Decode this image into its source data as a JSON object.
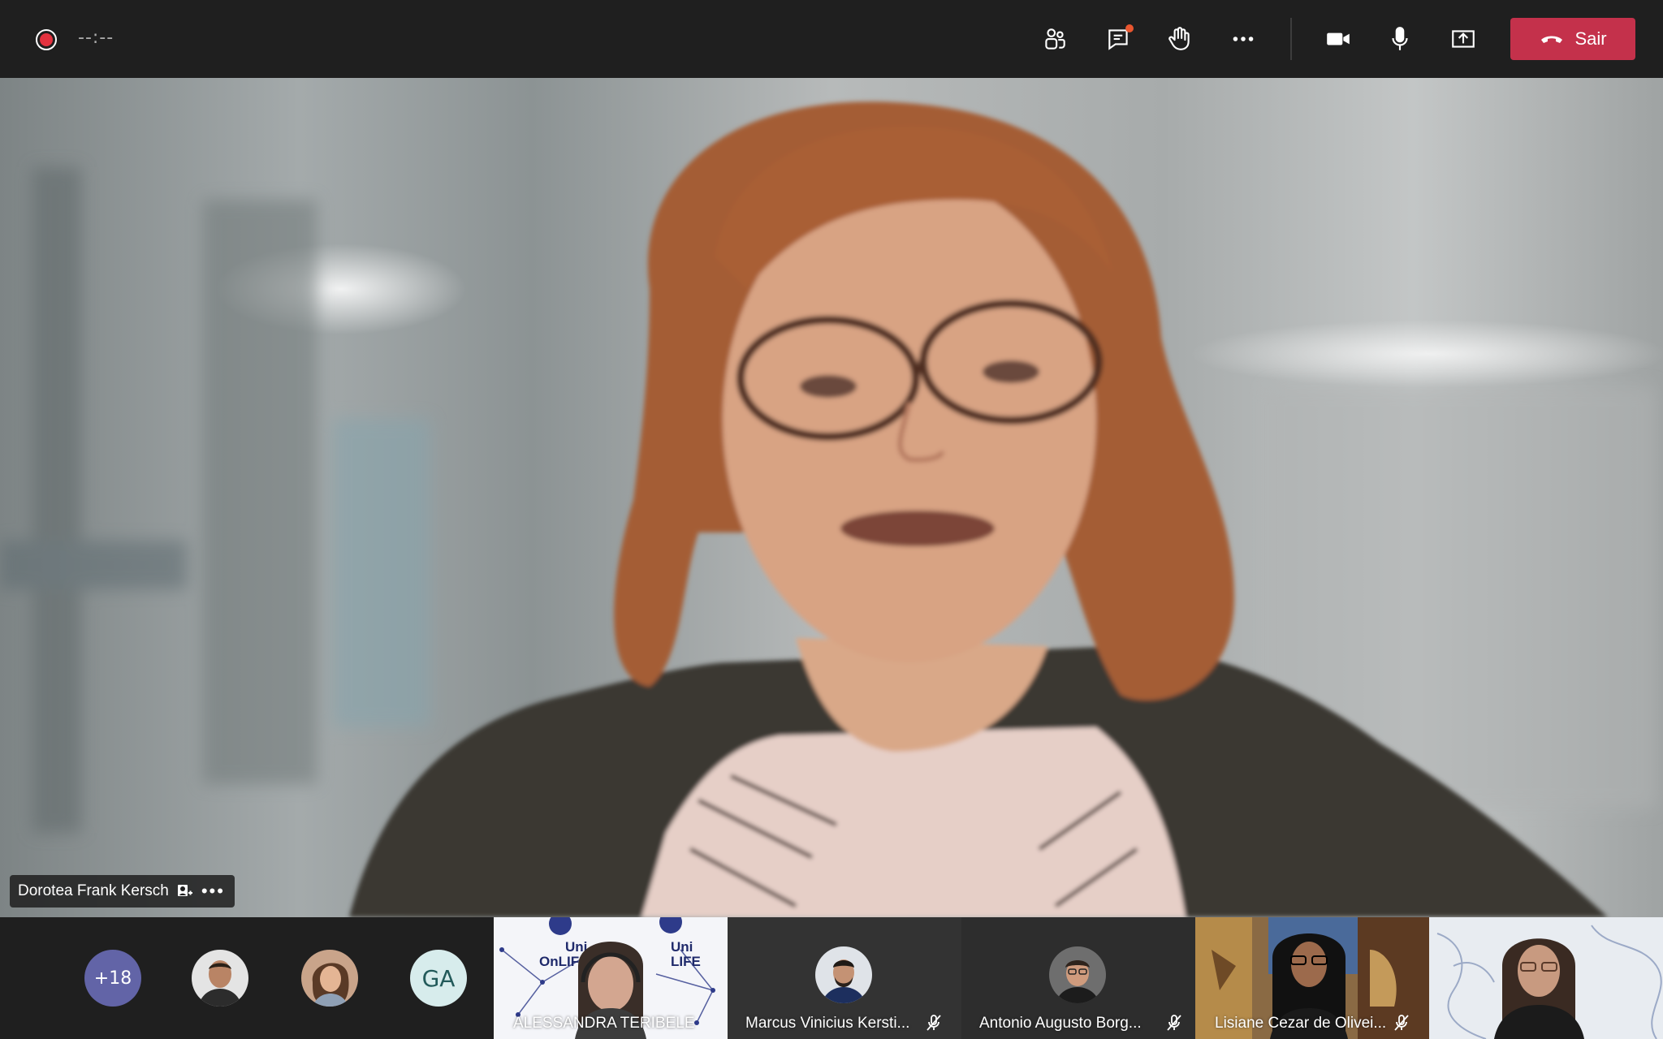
{
  "toolbar": {
    "timer": "--:--",
    "leave_label": "Sair",
    "icons": [
      "participants-icon",
      "chat-icon",
      "raise-hand-icon",
      "more-icon",
      "camera-icon",
      "mic-icon",
      "share-icon",
      "phone-hangup-icon"
    ]
  },
  "main": {
    "speaker_name": "Dorotea Frank Kersch"
  },
  "strip": {
    "overflow_count": "+18",
    "initials_avatar": "GA",
    "tiles": [
      {
        "name": "ALESSANDRA TERIBELE"
      },
      {
        "name": "Marcus Vinicius Kersti..."
      },
      {
        "name": "Antonio Augusto Borg..."
      },
      {
        "name": "Lisiane Cezar de Olivei..."
      }
    ],
    "poster_text_1": "Uni",
    "poster_text_2": "OnLIF",
    "poster_text_3": "Uni",
    "poster_text_4": "LIFE"
  },
  "colors": {
    "leave": "#c4314b",
    "record": "#e3323f",
    "overflow": "#6264a7",
    "bar": "#1f1f1f"
  }
}
